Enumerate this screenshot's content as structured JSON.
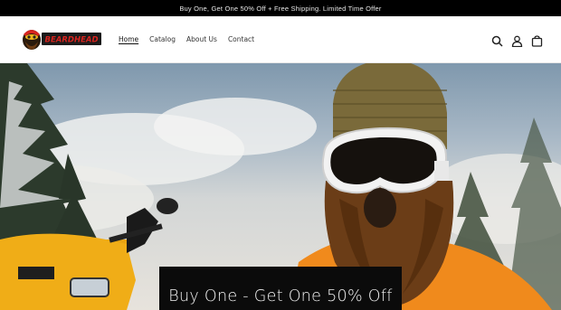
{
  "announcement": {
    "text": "Buy One, Get One 50% Off + Free Shipping. Limited Time Offer"
  },
  "header": {
    "logo_text": "BEARDHEAD",
    "nav": [
      {
        "label": "Home",
        "active": true
      },
      {
        "label": "Catalog",
        "active": false
      },
      {
        "label": "About Us",
        "active": false
      },
      {
        "label": "Contact",
        "active": false
      }
    ],
    "icons": [
      "search-icon",
      "account-icon",
      "cart-icon"
    ]
  },
  "hero": {
    "heading": "Buy One - Get One 50% Off"
  },
  "colors": {
    "announcement_bg": "#000000",
    "hero_orange": "#f08a1c",
    "atv_yellow": "#e9a412",
    "banner_bg": "#0b0b0b"
  }
}
